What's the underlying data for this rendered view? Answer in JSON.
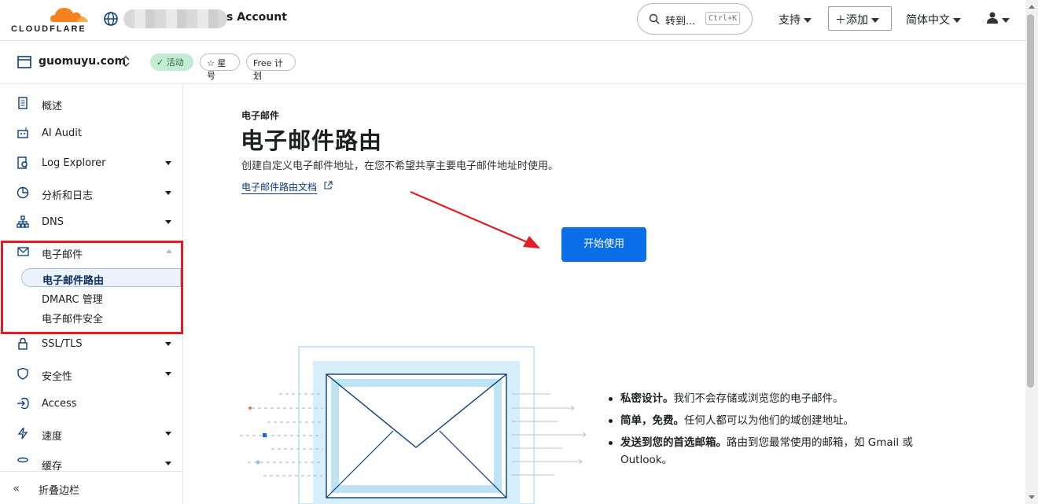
{
  "header": {
    "logo_text": "CLOUDFLARE",
    "account_suffix": "s Account",
    "search_label": "转到...",
    "search_shortcut": "Ctrl+K",
    "support_label": "支持",
    "add_label": "添加",
    "language_label": "简体中文"
  },
  "zone": {
    "name": "guomuyu.com",
    "status_badge": "活动",
    "star_label": "星号",
    "plan_badge": "Free 计划"
  },
  "sidebar": {
    "items": [
      {
        "label": "概述"
      },
      {
        "label": "AI Audit"
      },
      {
        "label": "Log Explorer"
      },
      {
        "label": "分析和日志"
      },
      {
        "label": "DNS"
      },
      {
        "label": "电子邮件"
      },
      {
        "label": "SSL/TLS"
      },
      {
        "label": "安全性"
      },
      {
        "label": "Access"
      },
      {
        "label": "速度"
      },
      {
        "label": "缓存"
      }
    ],
    "email_subitems": [
      {
        "label": "电子邮件路由"
      },
      {
        "label": "DMARC 管理"
      },
      {
        "label": "电子邮件安全"
      }
    ],
    "collapse_label": "折叠边栏"
  },
  "main": {
    "breadcrumb": "电子邮件",
    "title": "电子邮件路由",
    "description": "创建自定义电子邮件地址，在您不希望共享主要电子邮件地址时使用。",
    "doc_link": "电子邮件路由文档",
    "start_button": "开始使用",
    "features": [
      {
        "bold": "私密设计。",
        "text": "我们不会存储或浏览您的电子邮件。"
      },
      {
        "bold": "简单，免费。",
        "text": "任何人都可以为他们的域创建地址。"
      },
      {
        "bold": "发送到您的首选邮箱。",
        "text": "路由到您最常使用的邮箱，如 Gmail 或 Outlook。"
      }
    ]
  },
  "colors": {
    "brand_orange": "#f6821f",
    "primary_blue": "#0a6ee8",
    "annotation_red": "#e01e25",
    "active_green": "#c3ecd2"
  }
}
